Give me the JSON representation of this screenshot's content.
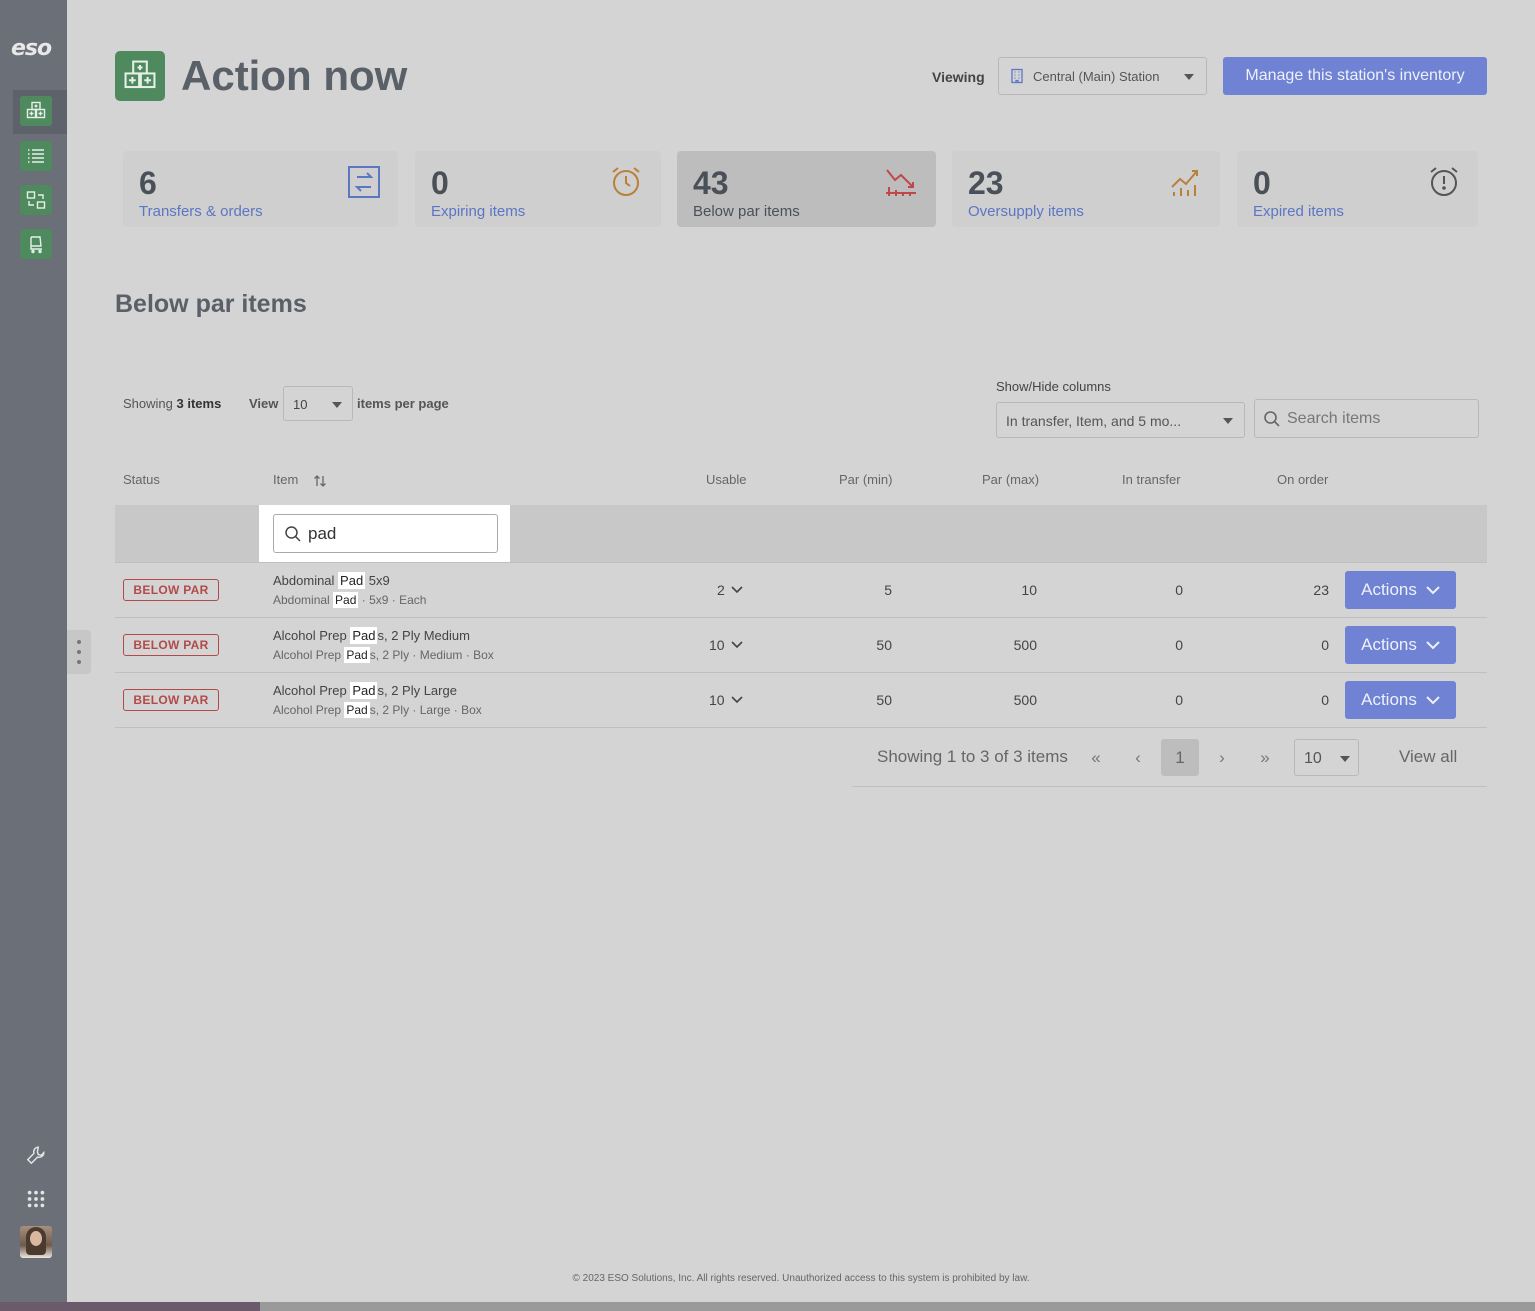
{
  "sidebar": {
    "logo": "eso",
    "nav": [
      {
        "icon": "medical-grid-icon",
        "active": true
      },
      {
        "icon": "list-icon",
        "active": false
      },
      {
        "icon": "transfer-icon",
        "active": false
      },
      {
        "icon": "cart-icon",
        "active": false
      }
    ],
    "tools": [
      "wrench-icon",
      "apps-grid-icon"
    ]
  },
  "header": {
    "title": "Action now",
    "viewing_label": "Viewing",
    "station": "Central (Main) Station",
    "manage_button": "Manage this station's inventory"
  },
  "stats": [
    {
      "value": "6",
      "label": "Transfers & orders",
      "icon": "transfer-arrows-icon",
      "icon_color": "#5b76c4",
      "active": false
    },
    {
      "value": "0",
      "label": "Expiring items",
      "icon": "alarm-clock-icon",
      "icon_color": "#b9803a",
      "active": false
    },
    {
      "value": "43",
      "label": "Below par items",
      "icon": "trend-down-icon",
      "icon_color": "#c04848",
      "active": true
    },
    {
      "value": "23",
      "label": "Oversupply items",
      "icon": "trend-up-icon",
      "icon_color": "#b9803a",
      "active": false
    },
    {
      "value": "0",
      "label": "Expired items",
      "icon": "alarm-alert-icon",
      "icon_color": "#555555",
      "active": false
    }
  ],
  "section_title": "Below par items",
  "toolbar": {
    "showing_prefix": "Showing",
    "showing_count": "3 items",
    "view_label": "View",
    "per_page": "10",
    "per_page_label": "items per page",
    "columns_label": "Show/Hide columns",
    "columns_value": "In transfer, Item, and 5 mo...",
    "search_placeholder": "Search items"
  },
  "table": {
    "headers": {
      "status": "Status",
      "item": "Item",
      "usable": "Usable",
      "par_min": "Par (min)",
      "par_max": "Par (max)",
      "in_transfer": "In transfer",
      "on_order": "On order"
    },
    "filter_value": "pad",
    "rows": [
      {
        "status": "BELOW PAR",
        "name_pre": "Abdominal ",
        "name_hl": "Pad",
        "name_post": " 5x9",
        "sub_pre": "Abdominal ",
        "sub_hl": "Pad",
        "sub_post": " · 5x9 · Each",
        "usable": "2",
        "par_min": "5",
        "par_max": "10",
        "in_transfer": "0",
        "on_order": "23",
        "action": "Actions"
      },
      {
        "status": "BELOW PAR",
        "name_pre": "Alcohol Prep ",
        "name_hl": "Pad",
        "name_post": "s, 2 Ply Medium",
        "sub_pre": "Alcohol Prep ",
        "sub_hl": "Pad",
        "sub_post": "s, 2 Ply · Medium · Box",
        "usable": "10",
        "par_min": "50",
        "par_max": "500",
        "in_transfer": "0",
        "on_order": "0",
        "action": "Actions"
      },
      {
        "status": "BELOW PAR",
        "name_pre": "Alcohol Prep ",
        "name_hl": "Pad",
        "name_post": "s, 2 Ply Large",
        "sub_pre": "Alcohol Prep ",
        "sub_hl": "Pad",
        "sub_post": "s, 2 Ply · Large · Box",
        "usable": "10",
        "par_min": "50",
        "par_max": "500",
        "in_transfer": "0",
        "on_order": "0",
        "action": "Actions"
      }
    ]
  },
  "pagination": {
    "summary": "Showing 1 to 3 of 3 items",
    "first": "«",
    "prev": "‹",
    "current": "1",
    "next": "›",
    "last": "»",
    "page_size": "10",
    "view_all": "View all"
  },
  "footer": "© 2023 ESO Solutions, Inc. All rights reserved. Unauthorized access to this system is prohibited by law.",
  "colors": {
    "accent": "#6f82d4",
    "green": "#4f8a5f",
    "alert": "#b24a4a"
  }
}
